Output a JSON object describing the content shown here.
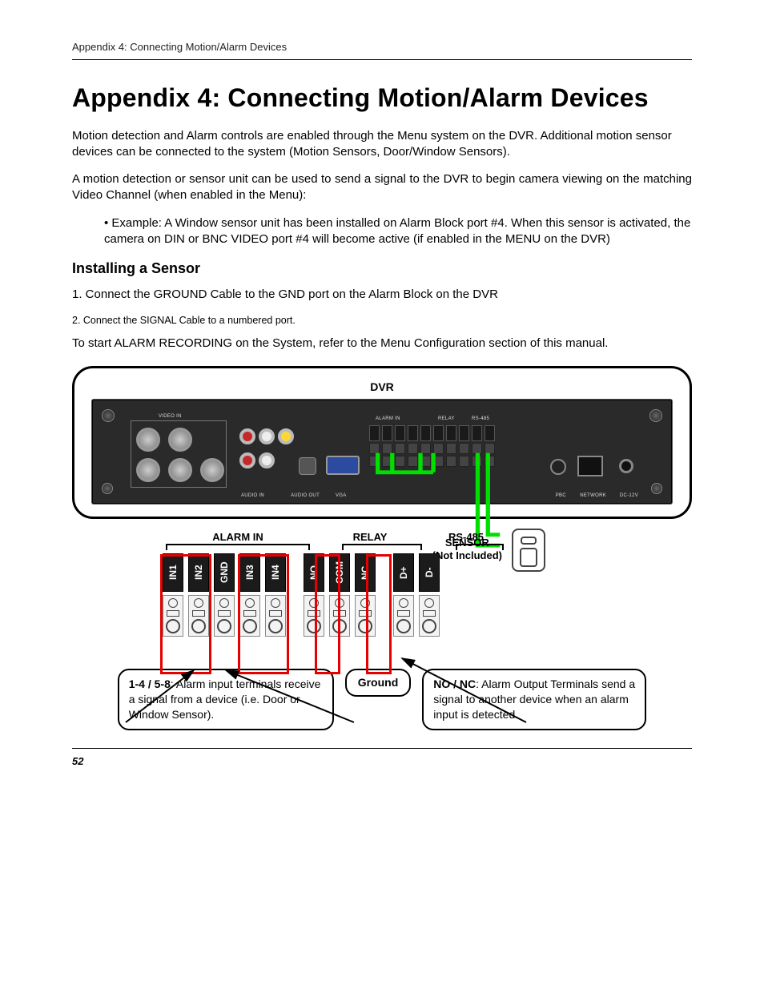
{
  "header": {
    "running": "Appendix 4: Connecting Motion/Alarm Devices"
  },
  "title": "Appendix 4: Connecting Motion/Alarm Devices",
  "para1": "Motion detection and Alarm controls are enabled through the Menu system on the DVR. Additional motion sensor devices can be connected to the system (Motion Sensors, Door/Window Sensors).",
  "para2": "A motion detection or sensor unit can be used to send a signal to the DVR to begin camera viewing on the matching Video Channel (when enabled in the Menu):",
  "bullet1": "Example: A Window sensor unit has been installed on Alarm Block port #4. When this sensor is activated, the camera on DIN or BNC VIDEO port #4 will become active (if enabled in the MENU on the DVR)",
  "subheading": "Installing a Sensor",
  "step1": "1. Connect the GROUND Cable to the GND port on the Alarm Block on the DVR",
  "step2": "2. Connect the SIGNAL Cable to a numbered port.",
  "para3": "To start ALARM RECORDING on the System, refer to the Menu Configuration section of this manual.",
  "diagram": {
    "dvr_label": "DVR",
    "sensor_caption_l1": "SENSOR",
    "sensor_caption_l2": "(Not Included)",
    "panel_text": {
      "video_in": "VIDEO IN",
      "audio_in": "AUDIO IN",
      "audio_out": "AUDIO OUT",
      "vga": "VGA",
      "alarm_in": "ALARM IN",
      "relay": "RELAY",
      "rs485": "RS-485",
      "pbc": "PBC",
      "network": "NETWORK",
      "dc12v": "DC-12V"
    },
    "groups": {
      "alarm_in": "ALARM IN",
      "relay": "RELAY",
      "rs485": "RS-485"
    },
    "pins": [
      "IN1",
      "IN2",
      "GND",
      "IN3",
      "IN4",
      "NO",
      "COM",
      "NC",
      "D+",
      "D-"
    ],
    "callout_inputs_bold": "1-4 / 5-8",
    "callout_inputs_rest": ": Alarm input terminals receive a signal from a device (i.e. Door or Window Sensor).",
    "callout_ground": "Ground",
    "callout_outputs_bold": "NO / NC",
    "callout_outputs_rest": ": Alarm Output Terminals send a signal to another device when an alarm input is detected."
  },
  "page_number": "52"
}
